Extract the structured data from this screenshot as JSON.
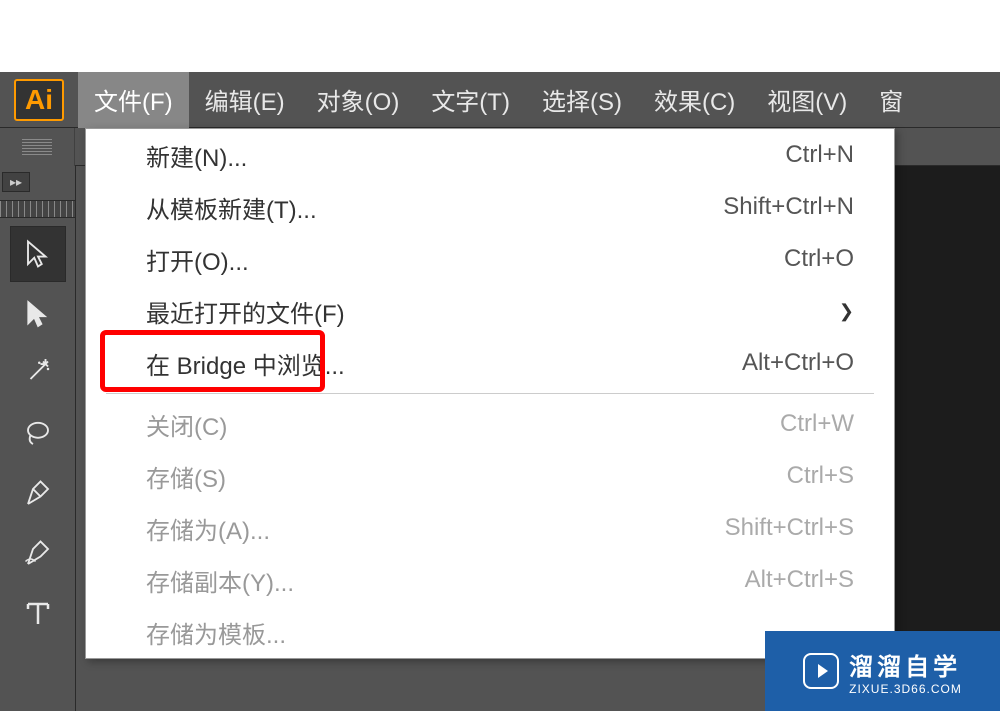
{
  "app": {
    "logo": "Ai"
  },
  "menubar": {
    "items": [
      {
        "label": "文件(F)",
        "active": true
      },
      {
        "label": "编辑(E)"
      },
      {
        "label": "对象(O)"
      },
      {
        "label": "文字(T)"
      },
      {
        "label": "选择(S)"
      },
      {
        "label": "效果(C)"
      },
      {
        "label": "视图(V)"
      },
      {
        "label": "窗"
      }
    ]
  },
  "fileMenu": {
    "new": {
      "label": "新建(N)...",
      "shortcut": "Ctrl+N"
    },
    "newFromTemplate": {
      "label": "从模板新建(T)...",
      "shortcut": "Shift+Ctrl+N"
    },
    "open": {
      "label": "打开(O)...",
      "shortcut": "Ctrl+O"
    },
    "openRecent": {
      "label": "最近打开的文件(F)"
    },
    "browseInBridge": {
      "label": "在 Bridge 中浏览...",
      "shortcut": "Alt+Ctrl+O"
    },
    "close": {
      "label": "关闭(C)",
      "shortcut": "Ctrl+W"
    },
    "save": {
      "label": "存储(S)",
      "shortcut": "Ctrl+S"
    },
    "saveAs": {
      "label": "存储为(A)...",
      "shortcut": "Shift+Ctrl+S"
    },
    "saveCopy": {
      "label": "存储副本(Y)...",
      "shortcut": "Alt+Ctrl+S"
    },
    "saveAsTemplate": {
      "label": "存储为模板..."
    }
  },
  "watermark": {
    "title": "溜溜自学",
    "url": "ZIXUE.3D66.COM"
  }
}
